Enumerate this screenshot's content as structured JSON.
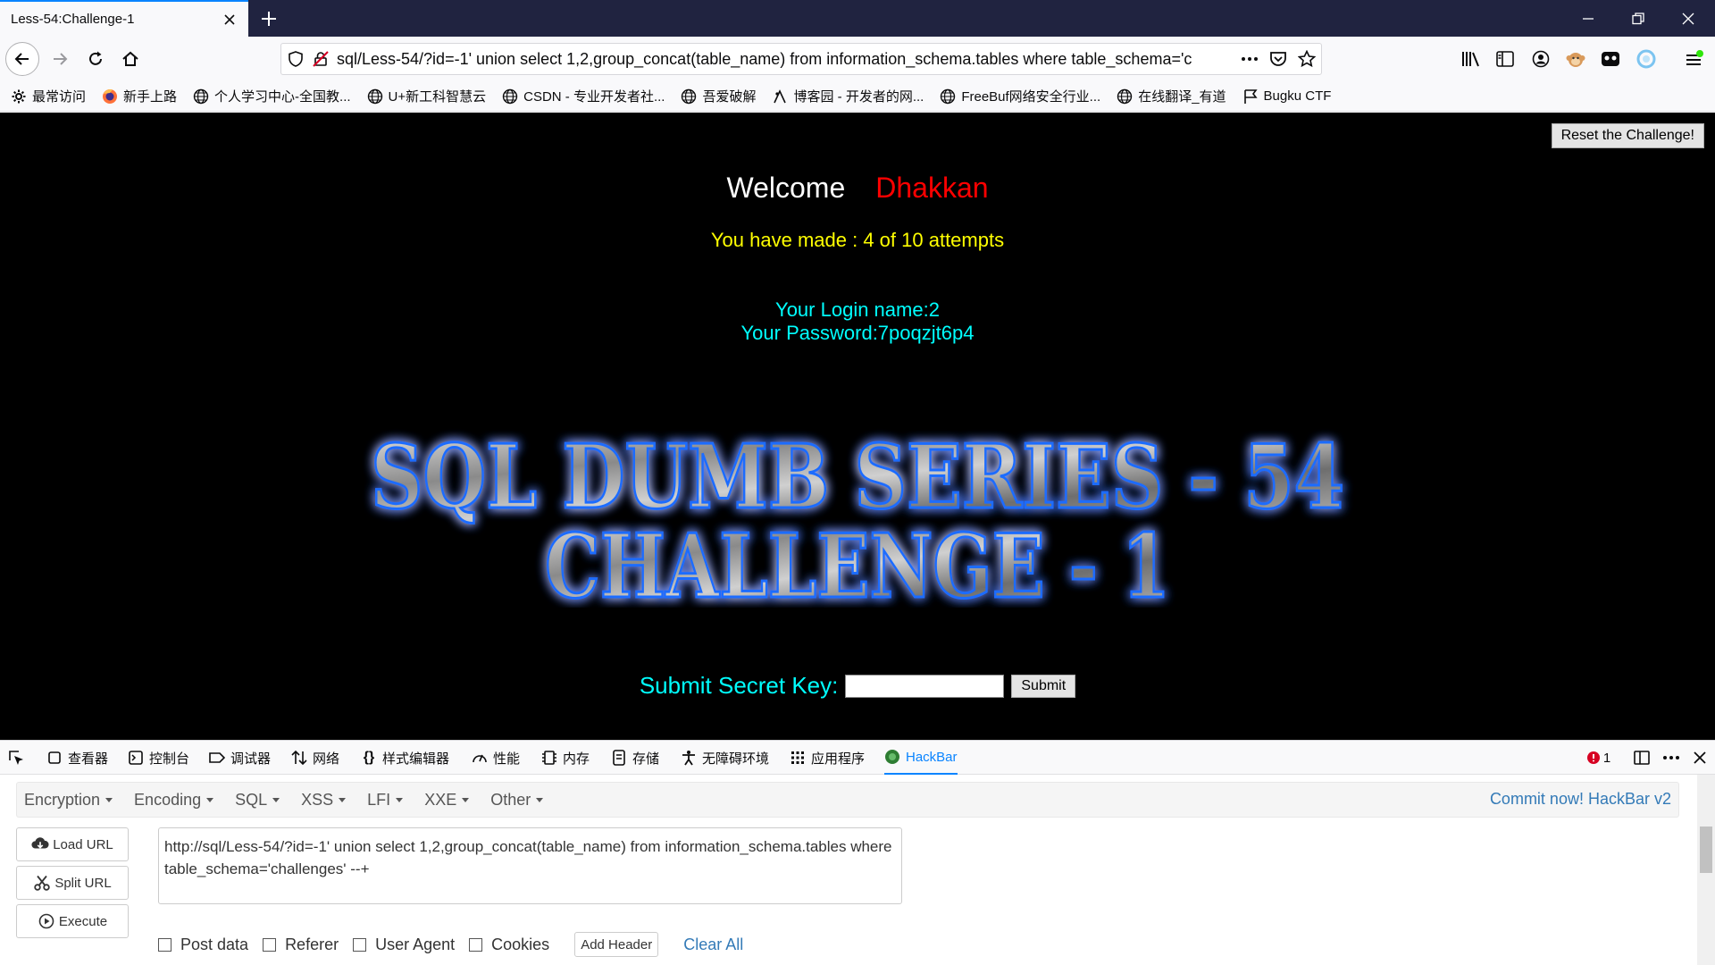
{
  "browser": {
    "tab_title": "Less-54:Challenge-1",
    "url_main": "sql/Less-54/?id=-1' union select 1,2,group_concat(table_name) from information_schema.tables where table_schema='c",
    "bookmarks": [
      {
        "label": "最常访问",
        "icon": "gear-icon"
      },
      {
        "label": "新手上路",
        "icon": "firefox-icon"
      },
      {
        "label": "个人学习中心-全国教...",
        "icon": "globe-icon"
      },
      {
        "label": "U+新工科智慧云",
        "icon": "globe-icon"
      },
      {
        "label": "CSDN - 专业开发者社...",
        "icon": "globe-icon"
      },
      {
        "label": "吾爱破解",
        "icon": "globe-icon"
      },
      {
        "label": "博客园 - 开发者的网...",
        "icon": "cnblogs-icon"
      },
      {
        "label": "FreeBuf网络安全行业...",
        "icon": "globe-icon"
      },
      {
        "label": "在线翻译_有道",
        "icon": "globe-icon"
      },
      {
        "label": "Bugku CTF",
        "icon": "flag-icon"
      }
    ]
  },
  "page": {
    "reset_label": "Reset the Challenge!",
    "welcome": "Welcome",
    "username": "Dhakkan",
    "attempts": "You have made : 4 of 10 attempts",
    "login_name": "Your Login name:2",
    "password": "Your Password:7poqzjt6p4",
    "banner_line1": "SQL DUMB SERIES - 54",
    "banner_line2": "CHALLENGE - 1",
    "secret_label": "Submit Secret Key:",
    "submit_label": "Submit"
  },
  "devtools": {
    "tabs": [
      {
        "label": "查看器",
        "icon": "inspector-icon"
      },
      {
        "label": "控制台",
        "icon": "console-icon"
      },
      {
        "label": "调试器",
        "icon": "debugger-icon"
      },
      {
        "label": "网络",
        "icon": "network-icon"
      },
      {
        "label": "样式编辑器",
        "icon": "style-editor-icon"
      },
      {
        "label": "性能",
        "icon": "performance-icon"
      },
      {
        "label": "内存",
        "icon": "memory-icon"
      },
      {
        "label": "存储",
        "icon": "storage-icon"
      },
      {
        "label": "无障碍环境",
        "icon": "accessibility-icon"
      },
      {
        "label": "应用程序",
        "icon": "application-icon"
      },
      {
        "label": "HackBar",
        "icon": "hackbar-icon"
      }
    ],
    "error_count": "1"
  },
  "hackbar": {
    "menu": [
      "Encryption",
      "Encoding",
      "SQL",
      "XSS",
      "LFI",
      "XXE",
      "Other"
    ],
    "commit_text": "Commit now! HackBar v2",
    "load_url": "Load URL",
    "split_url": "Split URL",
    "execute": "Execute",
    "url_value": "http://sql/Less-54/?id=-1' union select 1,2,group_concat(table_name) from information_schema.tables where table_schema='challenges' --+",
    "post_data": "Post data",
    "referer": "Referer",
    "user_agent": "User Agent",
    "cookies": "Cookies",
    "add_header": "Add Header",
    "clear_all": "Clear All"
  }
}
